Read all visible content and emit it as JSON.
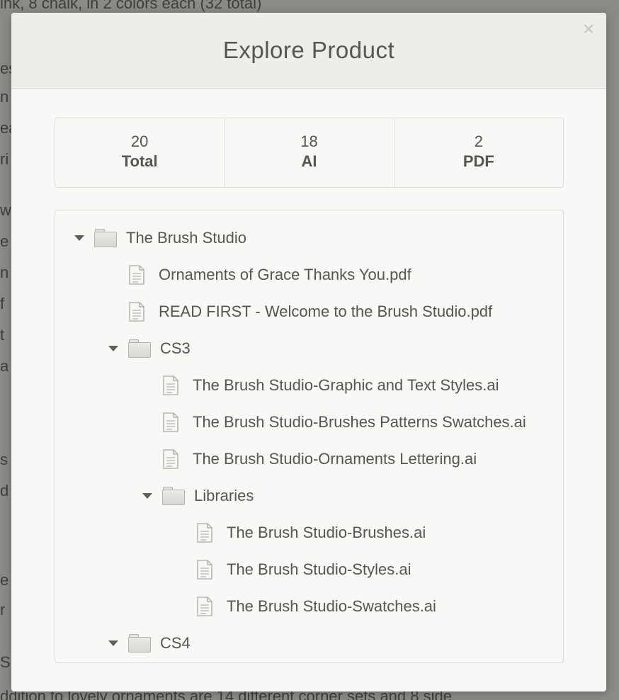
{
  "background": {
    "top_text": "ink, 8 chalk, in 2 colors each (32 total)",
    "bottom_text": "ddition to lovely ornaments are 14 different corner sets and 8 side",
    "fragments": [
      "es",
      "n",
      "ea",
      "ri",
      "w",
      "e",
      "n",
      "f",
      "t",
      "a",
      "s",
      "d",
      "e",
      "r",
      "S T"
    ]
  },
  "modal": {
    "title": "Explore Product",
    "close_glyph": "×"
  },
  "stats": [
    {
      "count": "20",
      "label": "Total"
    },
    {
      "count": "18",
      "label": "AI"
    },
    {
      "count": "2",
      "label": "PDF"
    }
  ],
  "tree": [
    {
      "type": "folder",
      "depth": 0,
      "expanded": true,
      "name": "The Brush Studio"
    },
    {
      "type": "file",
      "depth": 1,
      "name": "Ornaments of Grace Thanks You.pdf"
    },
    {
      "type": "file",
      "depth": 1,
      "name": "READ FIRST - Welcome to the Brush Studio.pdf"
    },
    {
      "type": "folder",
      "depth": 1,
      "expanded": true,
      "name": "CS3"
    },
    {
      "type": "file",
      "depth": 2,
      "name": "The Brush Studio-Graphic and Text Styles.ai"
    },
    {
      "type": "file",
      "depth": 2,
      "name": "The Brush Studio-Brushes Patterns Swatches.ai"
    },
    {
      "type": "file",
      "depth": 2,
      "name": "The Brush Studio-Ornaments Lettering.ai"
    },
    {
      "type": "folder",
      "depth": 2,
      "expanded": true,
      "name": "Libraries"
    },
    {
      "type": "file",
      "depth": 3,
      "name": "The Brush Studio-Brushes.ai"
    },
    {
      "type": "file",
      "depth": 3,
      "name": "The Brush Studio-Styles.ai"
    },
    {
      "type": "file",
      "depth": 3,
      "name": "The Brush Studio-Swatches.ai"
    },
    {
      "type": "folder",
      "depth": 1,
      "expanded": true,
      "name": "CS4"
    }
  ]
}
